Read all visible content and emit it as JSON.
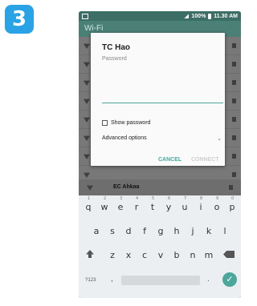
{
  "step_badge": "3",
  "status_bar": {
    "battery": "100%",
    "time": "11.30 AM"
  },
  "app_bar": {
    "title": "Wi-Fi"
  },
  "dialog": {
    "title": "TC Hao",
    "password_label": "Password",
    "password_value": "",
    "show_password_label": "Show password",
    "advanced_label": "Advanced options",
    "cancel_label": "CANCEL",
    "connect_label": "CONNECT"
  },
  "network_row": {
    "name": "EC Ahkaa"
  },
  "keyboard": {
    "row1": [
      "q",
      "w",
      "e",
      "r",
      "t",
      "y",
      "u",
      "i",
      "o",
      "p"
    ],
    "row1_hints": [
      "1",
      "2",
      "3",
      "4",
      "5",
      "6",
      "7",
      "8",
      "9",
      "0"
    ],
    "row2": [
      "a",
      "s",
      "d",
      "f",
      "g",
      "h",
      "j",
      "k",
      "l"
    ],
    "row3": [
      "z",
      "x",
      "c",
      "v",
      "b",
      "n",
      "m"
    ],
    "symbols_label": "?123",
    "comma": ",",
    "period": "."
  },
  "colors": {
    "accent": "#4aa79a",
    "badge": "#29a3e6",
    "status_bar": "#3c6e66"
  }
}
